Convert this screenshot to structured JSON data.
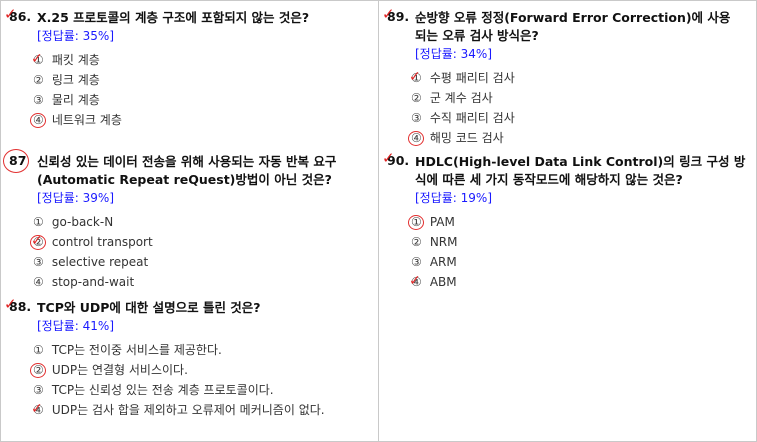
{
  "left": [
    {
      "number": "86.",
      "text": "X.25 프로토콜의 계층 구조에 포함되지 않는 것은?",
      "rate": "[정답률: 35%]",
      "number_mark": "check",
      "options": [
        {
          "mark": "①",
          "label": "패킷 계층",
          "annot": "check"
        },
        {
          "mark": "②",
          "label": "링크 계층",
          "annot": ""
        },
        {
          "mark": "③",
          "label": "물리 계층",
          "annot": ""
        },
        {
          "mark": "④",
          "label": "네트워크 계층",
          "annot": "circle"
        }
      ]
    },
    {
      "number": "87",
      "text": "신뢰성 있는 데이터 전송을 위해 사용되는 자동 반복 요구(Automatic Repeat reQuest)방법이 아닌 것은?",
      "rate": "[정답률: 39%]",
      "number_mark": "circle",
      "options": [
        {
          "mark": "①",
          "label": "go-back-N",
          "annot": ""
        },
        {
          "mark": "②",
          "label": "control transport",
          "annot": "circle-check"
        },
        {
          "mark": "③",
          "label": "selective repeat",
          "annot": ""
        },
        {
          "mark": "④",
          "label": "stop-and-wait",
          "annot": ""
        }
      ]
    },
    {
      "number": "88.",
      "text": "TCP와 UDP에 대한 설명으로 틀린 것은?",
      "rate": "[정답률: 41%]",
      "number_mark": "check",
      "options": [
        {
          "mark": "①",
          "label": "TCP는 전이중 서비스를 제공한다.",
          "annot": ""
        },
        {
          "mark": "②",
          "label": "UDP는 연결형 서비스이다.",
          "annot": "circle"
        },
        {
          "mark": "③",
          "label": "TCP는 신뢰성 있는 전송 계층 프로토콜이다.",
          "annot": ""
        },
        {
          "mark": "④",
          "label": "UDP는 검사 합을 제외하고 오류제어 메커니즘이 없다.",
          "annot": "check"
        }
      ]
    }
  ],
  "right": [
    {
      "number": "89.",
      "text": "순방향 오류 정정(Forward Error Correction)에 사용 되는 오류 검사 방식은?",
      "rate": "[정답률: 34%]",
      "number_mark": "check",
      "options": [
        {
          "mark": "①",
          "label": "수평 패리티 검사",
          "annot": "check"
        },
        {
          "mark": "②",
          "label": "군 계수 검사",
          "annot": ""
        },
        {
          "mark": "③",
          "label": "수직 패리티 검사",
          "annot": ""
        },
        {
          "mark": "④",
          "label": "해밍 코드 검사",
          "annot": "circle"
        }
      ]
    },
    {
      "number": "90.",
      "text": "HDLC(High-level Data Link Control)의 링크 구성 방식에 따른 세 가지 동작모드에 해당하지 않는 것은?",
      "rate": "[정답률: 19%]",
      "number_mark": "check",
      "options": [
        {
          "mark": "①",
          "label": "PAM",
          "annot": "circle"
        },
        {
          "mark": "②",
          "label": "NRM",
          "annot": ""
        },
        {
          "mark": "③",
          "label": "ARM",
          "annot": ""
        },
        {
          "mark": "④",
          "label": "ABM",
          "annot": "check"
        }
      ]
    }
  ]
}
